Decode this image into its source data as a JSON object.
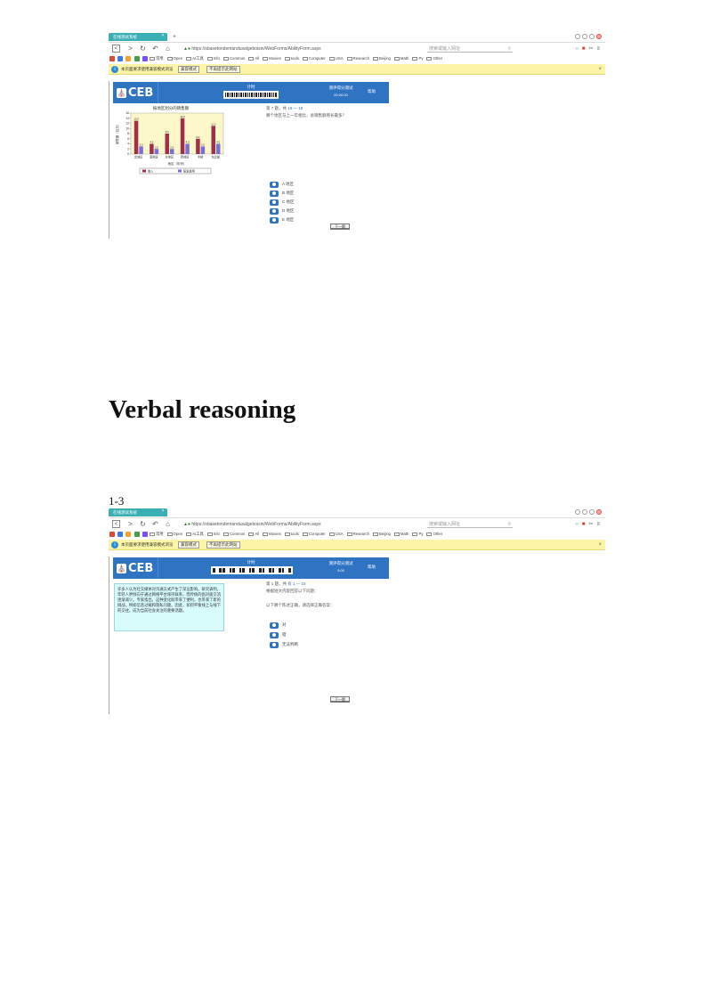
{
  "section_heading": "Verbal reasoning",
  "page_label": "1-3",
  "screenshots": [
    {
      "browser": {
        "tab_title": "在线测试系统",
        "tab_close": "×",
        "new_tab": "+",
        "address": "https://sbasetondemandusalgeboisin/WebForms/AbilityForm.aspx",
        "search_placeholder": "搜索或输入网址",
        "bookmarks": [
          "常用",
          "Open",
          "AI工具",
          "Info",
          "Common",
          "All",
          "Movies",
          "tools",
          "Computer",
          "USA",
          "Research",
          "Beijing",
          "Math",
          "Py",
          "Other"
        ],
        "info_text": "本页面要求使用兼容模式浏览",
        "info_button_1": "兼容模式",
        "info_button_2": "不再提示此网站",
        "info_close": "×"
      },
      "page": {
        "logo": "CEB",
        "timer_label": "计时",
        "score_label": "测评得分测试",
        "score_value": "00:00:00",
        "help_label": "帮助",
        "question_number_prefix": "第 7 题，共",
        "question_number_hl": "18 — 18",
        "question_text": "哪个地区与上一年相比，总销售额增长最多？",
        "options": [
          "A 地区",
          "B 地区",
          "C 地区",
          "D 地区",
          "E 地区"
        ],
        "next_button": "下一题"
      },
      "chart_data": {
        "type": "bar",
        "title": "按地区划分的销售额",
        "xlabel": "地区（年份）",
        "ylabel": "销售额（百万）",
        "ylim": [
          0,
          16
        ],
        "yticks": [
          0,
          2,
          4,
          6,
          8,
          10,
          12,
          14,
          16
        ],
        "categories": [
          "北地区",
          "南地区",
          "东地区",
          "西地区",
          "中部",
          "东北部"
        ],
        "series": [
          {
            "name": "收入",
            "color": "#a0304a",
            "values": [
              13.0,
              4.0,
              8.0,
              14.0,
              6.0,
              11.0
            ]
          },
          {
            "name": "研发费用",
            "color": "#7a6fd8",
            "values": [
              3.0,
              2.0,
              2.0,
              4.0,
              3.0,
              4.0
            ]
          }
        ],
        "grid": false,
        "legend_position": "bottom"
      }
    },
    {
      "browser": {
        "tab_title": "在线测试系统",
        "tab_close": "×",
        "address": "https://sbasetondemandusalgeboisin/WebForms/AbilityForm.aspx",
        "search_placeholder": "搜索或输入网址",
        "info_text": "本页面要求使用兼容模式浏览",
        "info_button_1": "兼容模式",
        "info_button_2": "不再提示此网站",
        "info_close": "×"
      },
      "page": {
        "logo": "CEB",
        "timer_label": "计时",
        "score_label": "测评得分测试",
        "score_value": "0:00",
        "help_label": "帮助",
        "question_number_prefix": "第 1 题，共",
        "question_number_hl": "有 1 — 10",
        "question_text": "根据短文内容回答以下问题：",
        "question_text_2": "以下哪个陈述正确，请选择正确答案：",
        "passage": "许多人认为社交媒体对沟通方式产生了深远影响。研究表明，年轻人更倾向于通过网络平台保持联系，而传统的面对面交流逐渐减少。专家指出，这种变化既带来了便利，也带来了新的挑战，例如信息过载和隐私问题。因此，如何平衡线上与线下的交往，成为当前社会关注的重要话题。",
        "options": [
          "对",
          "错",
          "无法判断"
        ],
        "next_button": "下一题"
      }
    }
  ]
}
